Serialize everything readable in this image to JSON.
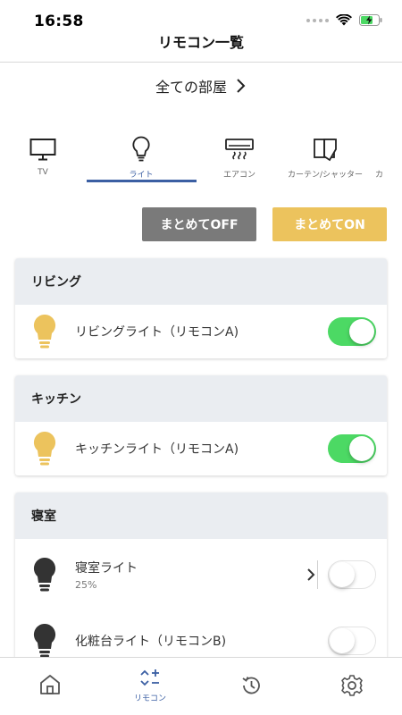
{
  "status_bar": {
    "time": "16:58"
  },
  "nav": {
    "title": "リモコン一覧"
  },
  "room_selector": {
    "label": "全ての部屋"
  },
  "categories": [
    {
      "label": "TV",
      "icon": "tv-icon"
    },
    {
      "label": "ライト",
      "icon": "light-bulb-icon",
      "active": true
    },
    {
      "label": "エアコン",
      "icon": "air-conditioner-icon"
    },
    {
      "label": "カーテン/シャッター",
      "icon": "curtain-icon"
    },
    {
      "label": "カ",
      "icon": "partial-tab"
    }
  ],
  "bulk": {
    "off_label": "まとめてOFF",
    "on_label": "まとめてON"
  },
  "rooms": [
    {
      "name": "リビング",
      "devices": [
        {
          "name": "リビングライト（リモコンA)",
          "on": true
        }
      ]
    },
    {
      "name": "キッチン",
      "devices": [
        {
          "name": "キッチンライト（リモコンA)",
          "on": true
        }
      ]
    },
    {
      "name": "寝室",
      "devices": [
        {
          "name": "寝室ライト",
          "sub": "25%",
          "on": false
        },
        {
          "name": "化粧台ライト（リモコンB)",
          "on": false
        }
      ]
    }
  ],
  "tabbar": {
    "remote_label": "リモコン"
  },
  "colors": {
    "accent": "#3b5fa3",
    "on_button": "#ecc35d",
    "off_button": "#7a7a7a",
    "toggle_on": "#4cd964",
    "bulb_on": "#ecc35d",
    "bulb_off": "#333333"
  }
}
